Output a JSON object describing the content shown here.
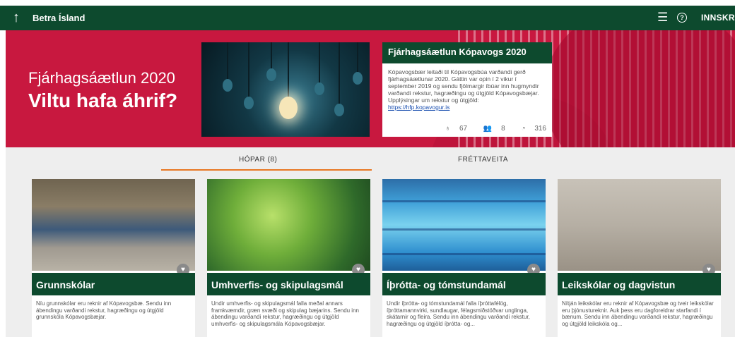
{
  "topbar": {
    "back_icon": "↑",
    "brand": "Betra Ísland",
    "menu_icon": "☰",
    "help_icon": "?",
    "login": "INNSKRÁ"
  },
  "hero": {
    "line1": "Fjárhagsáætlun 2020",
    "line2": "Viltu hafa áhrif?",
    "card": {
      "title": "Fjárhagsáætlun Kópavogs 2020",
      "body": "Kópavogsbær leitaði til Kópavogsbúa varðandi gerð fjárhagsáætlunar 2020. Gáttin var opin í 2 vikur í september 2019 og sendu fjölmargir íbúar inn hugmyndir varðandi rekstur, hagræðingu og útgjöld Kópavogsbæjar. Upplýsingar um rekstur og útgjöld:",
      "link": "https://hfp.kopavogur.is",
      "stats": {
        "ideas": "67",
        "members": "8",
        "comments": "316"
      }
    }
  },
  "tabs": [
    {
      "label": "HÓPAR (8)"
    },
    {
      "label": "FRÉTTAVEITA"
    }
  ],
  "groups": [
    {
      "title": "Grunnskólar",
      "desc": "Níu grunnskólar eru reknir af Kópavogsbæ. Sendu inn ábendingu varðandi rekstur, hagræðingu og útgjöld grunnskóla Kópavogsbæjar."
    },
    {
      "title": "Umhverfis- og skipulagsmál",
      "desc": "Undir umhverfis- og skipulagsmál falla meðal annars framkvæmdir, græn svæði og skipulag bæjarins. Sendu inn ábendingu varðandi rekstur, hagræðingu og útgjöld umhverfis- og skipulagsmála Kópavogsbæjar."
    },
    {
      "title": "Íþrótta- og tómstundamál",
      "desc": "Undir íþrótta- og tómstundamál falla íþróttafélög, íþróttamannvirki, sundlaugar, félagsmiðstöðvar unglinga, skátarnir og fleira. Sendu inn ábendingu varðandi rekstur, hagræðingu og útgjöld íþrótta- og..."
    },
    {
      "title": "Leikskólar og dagvistun",
      "desc": "Nítján leikskólar eru reknir af Kópavogsbæ og tveir leikskólar eru þjónustureknir. Auk þess eru dagforeldrar starfandi í bænum. Sendu inn ábendingu varðandi rekstur, hagræðingu og útgjöld leikskóla og..."
    }
  ],
  "colors": {
    "topbar": "#0d4a2e",
    "hero": "#c8183f",
    "accent": "#e87722"
  }
}
